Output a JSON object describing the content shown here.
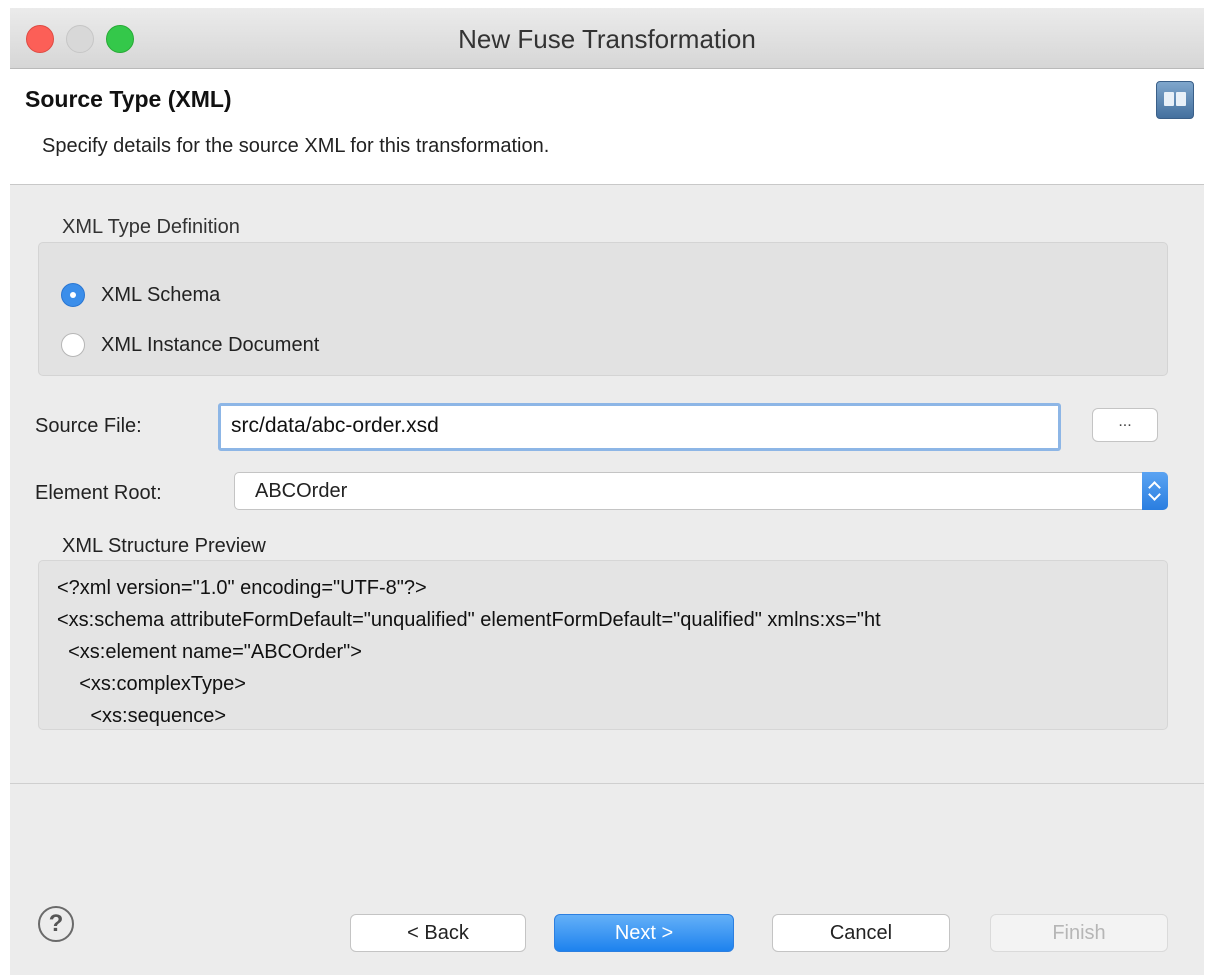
{
  "window": {
    "title": "New Fuse Transformation"
  },
  "header": {
    "title": "Source Type (XML)",
    "description": "Specify details for the source XML for this transformation."
  },
  "type_group": {
    "label": "XML Type Definition",
    "options": [
      {
        "label": "XML Schema",
        "selected": true
      },
      {
        "label": "XML Instance Document",
        "selected": false
      }
    ]
  },
  "source_file": {
    "label": "Source File:",
    "value": "src/data/abc-order.xsd",
    "browse_label": "..."
  },
  "element_root": {
    "label": "Element Root:",
    "value": "ABCOrder"
  },
  "preview": {
    "label": "XML Structure Preview",
    "lines": [
      "<?xml version=\"1.0\" encoding=\"UTF-8\"?>",
      "<xs:schema attributeFormDefault=\"unqualified\" elementFormDefault=\"qualified\" xmlns:xs=\"ht",
      "  <xs:element name=\"ABCOrder\">",
      "    <xs:complexType>",
      "      <xs:sequence>"
    ]
  },
  "buttons": {
    "help": "?",
    "back": "< Back",
    "next": "Next >",
    "cancel": "Cancel",
    "finish": "Finish"
  },
  "icons": {
    "help": "help-circle-icon",
    "wizard_banner": "wizard-banner-icon",
    "dropdown": "chevron-up-down-icon"
  },
  "colors": {
    "accent": "#3b8eea",
    "close": "#fc5f57",
    "maximize": "#34c84a"
  }
}
